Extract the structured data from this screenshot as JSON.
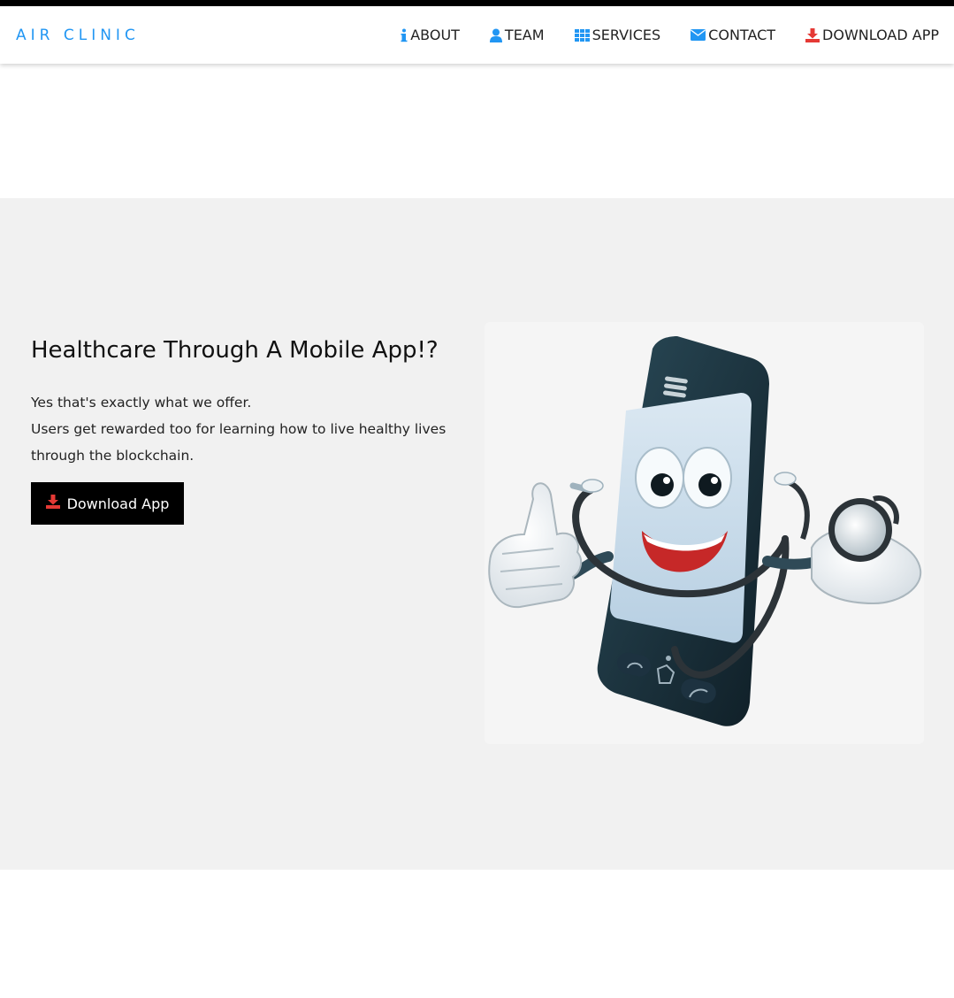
{
  "brand": {
    "name": "AIR CLINIC"
  },
  "nav": {
    "items": [
      {
        "label": "ABOUT",
        "icon": "info-icon"
      },
      {
        "label": "TEAM",
        "icon": "user-icon"
      },
      {
        "label": "SERVICES",
        "icon": "grid-icon"
      },
      {
        "label": "CONTACT",
        "icon": "envelope-icon"
      },
      {
        "label": "DOWNLOAD APP",
        "icon": "download-icon"
      }
    ]
  },
  "hero": {
    "title": "Healthcare Through A Mobile App!?",
    "lines": [
      "Yes that's exactly what we offer.",
      "Users get rewarded too for learning how to live healthy lives",
      "through the blockchain."
    ],
    "button_label": "Download App",
    "image": "smiling-phone-doctor-illustration"
  },
  "colors": {
    "brand": "#2196f3",
    "nav_icon": "#2196f3",
    "download_icon": "#e53935",
    "hero_bg": "#f1f1f1",
    "button_bg": "#000000"
  }
}
